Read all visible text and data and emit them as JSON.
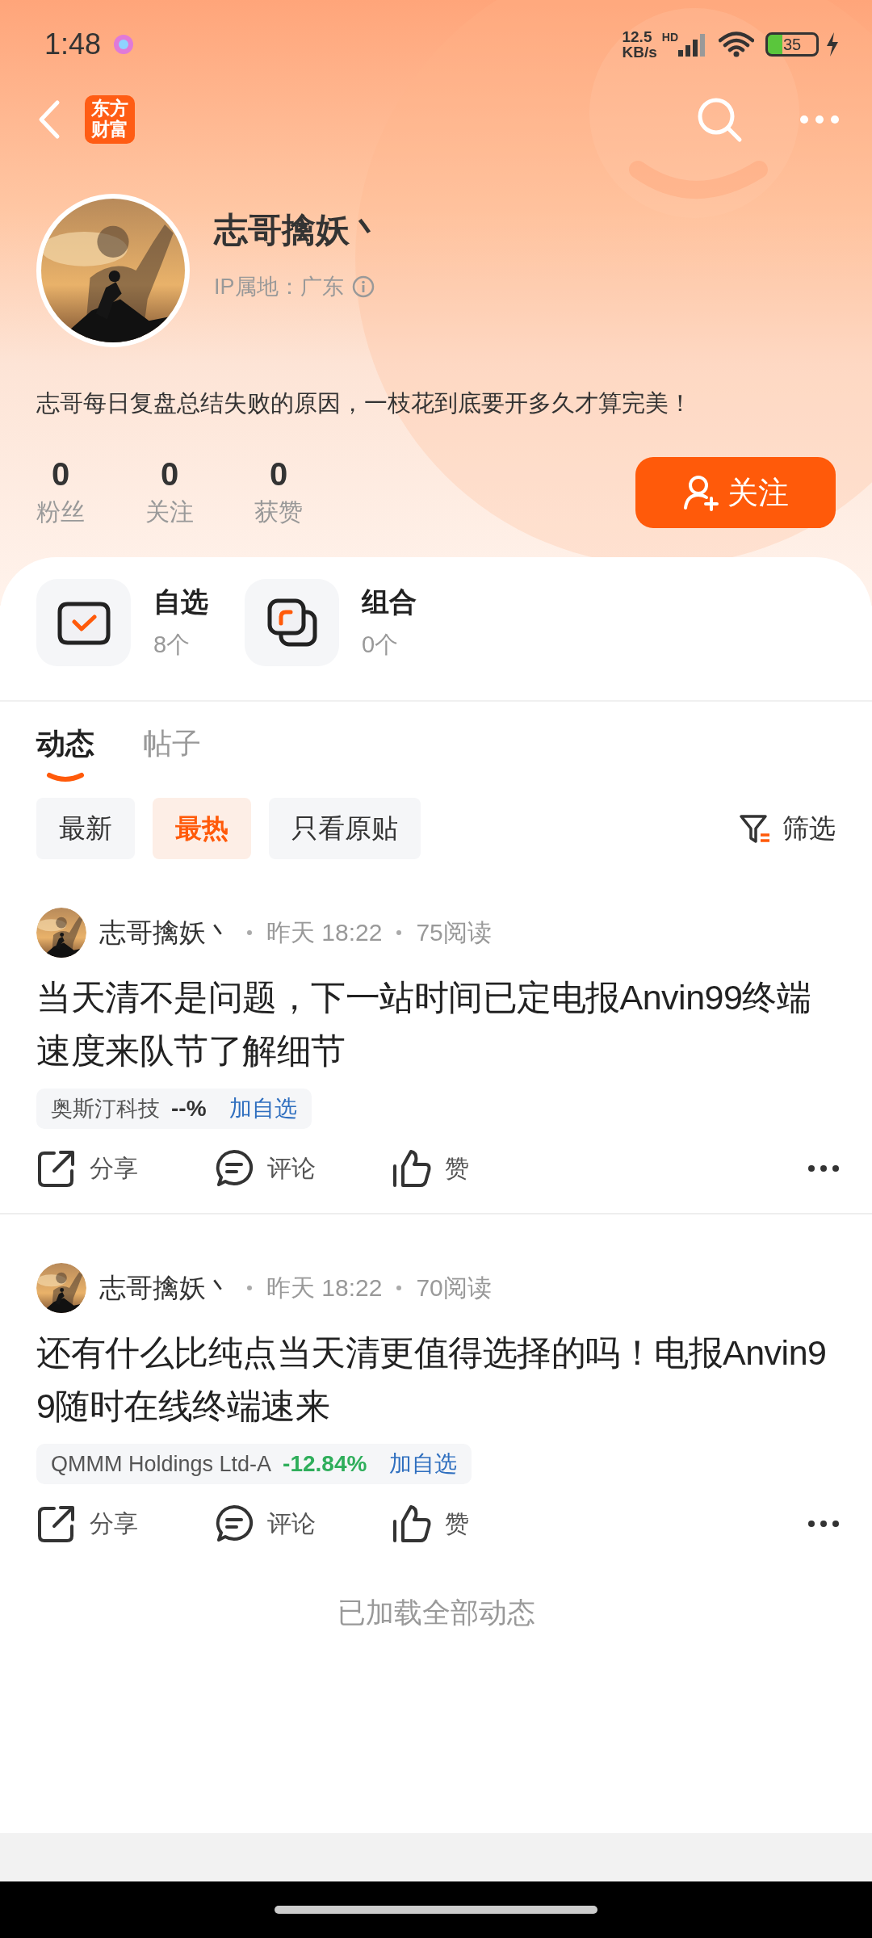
{
  "status_bar": {
    "time": "1:48",
    "speed_value": "12.5",
    "speed_unit": "KB/s",
    "network": "HD",
    "battery": "35"
  },
  "nav": {
    "logo": "东方财富"
  },
  "profile": {
    "name": "志哥擒妖丶",
    "ip_location": "IP属地：广东",
    "bio": "志哥每日复盘总结失败的原因，一枝花到底要开多久才算完美！",
    "stats": [
      {
        "value": "0",
        "label": "粉丝"
      },
      {
        "value": "0",
        "label": "关注"
      },
      {
        "value": "0",
        "label": "获赞"
      }
    ],
    "follow_button": "关注"
  },
  "shortcuts": [
    {
      "kind": "watchlist",
      "title": "自选",
      "count": "8个"
    },
    {
      "kind": "portfolio",
      "title": "组合",
      "count": "0个"
    }
  ],
  "tabs": [
    {
      "label": "动态",
      "selected": true
    },
    {
      "label": "帖子",
      "selected": false
    }
  ],
  "filters": [
    {
      "label": "最新",
      "selected": false
    },
    {
      "label": "最热",
      "selected": true
    },
    {
      "label": "只看原贴",
      "selected": false
    }
  ],
  "filter_button": "筛选",
  "posts": [
    {
      "author": "志哥擒妖丶",
      "time": "昨天 18:22",
      "reads": "75阅读",
      "title": "当天清不是问题，下一站时间已定电报Anvin99终端速度来队节了解细节",
      "stock": {
        "name": "奥斯汀科技",
        "change": "--%",
        "color": "#333333",
        "action": "加自选"
      },
      "actions": [
        "分享",
        "评论",
        "赞"
      ]
    },
    {
      "author": "志哥擒妖丶",
      "time": "昨天 18:22",
      "reads": "70阅读",
      "title": "还有什么比纯点当天清更值得选择的吗！电报Anvin99随时在线终端速来",
      "stock": {
        "name": "QMMM Holdings Ltd-A",
        "change": "-12.84%",
        "color": "#2fae5b",
        "action": "加自选"
      },
      "actions": [
        "分享",
        "评论",
        "赞"
      ]
    }
  ],
  "footer": "已加载全部动态"
}
